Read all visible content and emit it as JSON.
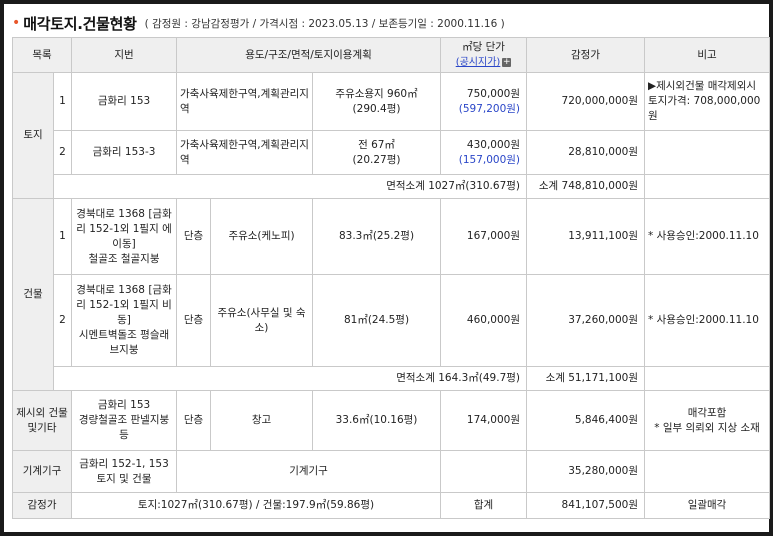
{
  "title": {
    "main": "매각토지.건물현황",
    "sub": "( 감정원 : 강남감정평가 / 가격시점 : 2023.05.13 / 보존등기일 : 2000.11.16 )"
  },
  "headers": {
    "category": "목록",
    "lot": "지번",
    "usage": "용도/구조/면적/토지이용계획",
    "unit_price": "㎡당 단가",
    "official": "(공시지가)",
    "plus": "+",
    "appraisal": "감정가",
    "remarks": "비고"
  },
  "land": {
    "label": "토지",
    "rows": [
      {
        "no": "1",
        "lot": "금화리 153",
        "zone": "가축사육제한구역,계획관리지역",
        "use": "주유소용지 960㎡",
        "area": "(290.4평)",
        "price": "750,000원",
        "official": "(597,200원)",
        "value": "720,000,000원",
        "remark": "▶제시외건물 매각제외시 토지가격: 708,000,000원"
      },
      {
        "no": "2",
        "lot": "금화리 153-3",
        "zone": "가축사육제한구역,계획관리지역",
        "use": "전 67㎡",
        "area": "(20.27평)",
        "price": "430,000원",
        "official": "(157,000원)",
        "value": "28,810,000원",
        "remark": ""
      }
    ],
    "area_sum": "면적소계 1027㎡(310.67평)",
    "sum": "소계 748,810,000원"
  },
  "building": {
    "label": "건물",
    "rows": [
      {
        "no": "1",
        "lot": "경북대로 1368 [금화리 152-1외 1필지 에이동]",
        "structure": "철골조 철골지붕",
        "floor": "단층",
        "use": "주유소(케노피)",
        "area": "83.3㎡(25.2평)",
        "price": "167,000원",
        "value": "13,911,100원",
        "remark": "* 사용승인:2000.11.10"
      },
      {
        "no": "2",
        "lot": "경북대로 1368 [금화리 152-1외 1필지 비동]",
        "structure": "시멘트벽돌조 평슬래브지붕",
        "floor": "단층",
        "use": "주유소(사무실 및 숙소)",
        "area": "81㎡(24.5평)",
        "price": "460,000원",
        "value": "37,260,000원",
        "remark": "* 사용승인:2000.11.10"
      }
    ],
    "area_sum": "면적소계 164.3㎡(49.7평)",
    "sum": "소계 51,171,100원"
  },
  "extra": {
    "label": "제시외 건물및기타",
    "lot": "금화리 153",
    "structure": "경량철골조 판넬지붕등",
    "floor": "단층",
    "use": "창고",
    "area": "33.6㎡(10.16평)",
    "price": "174,000원",
    "value": "5,846,400원",
    "remark_1": "매각포함",
    "remark_2": "* 일부 의뢰외 지상 소재"
  },
  "machine": {
    "label": "기계기구",
    "lot": "금화리 152-1, 153 토지 및 건물",
    "use": "기계기구",
    "value": "35,280,000원"
  },
  "total": {
    "label": "감정가",
    "summary": "토지:1027㎡(310.67평) / 건물:197.9㎡(59.86평)",
    "total_label": "합계",
    "value": "841,107,500원",
    "remark": "일괄매각"
  },
  "colors": {
    "header_bg": "#efefef",
    "border": "#c9c9c9",
    "link_blue": "#2a46c8",
    "title_dot": "#e8562a"
  }
}
